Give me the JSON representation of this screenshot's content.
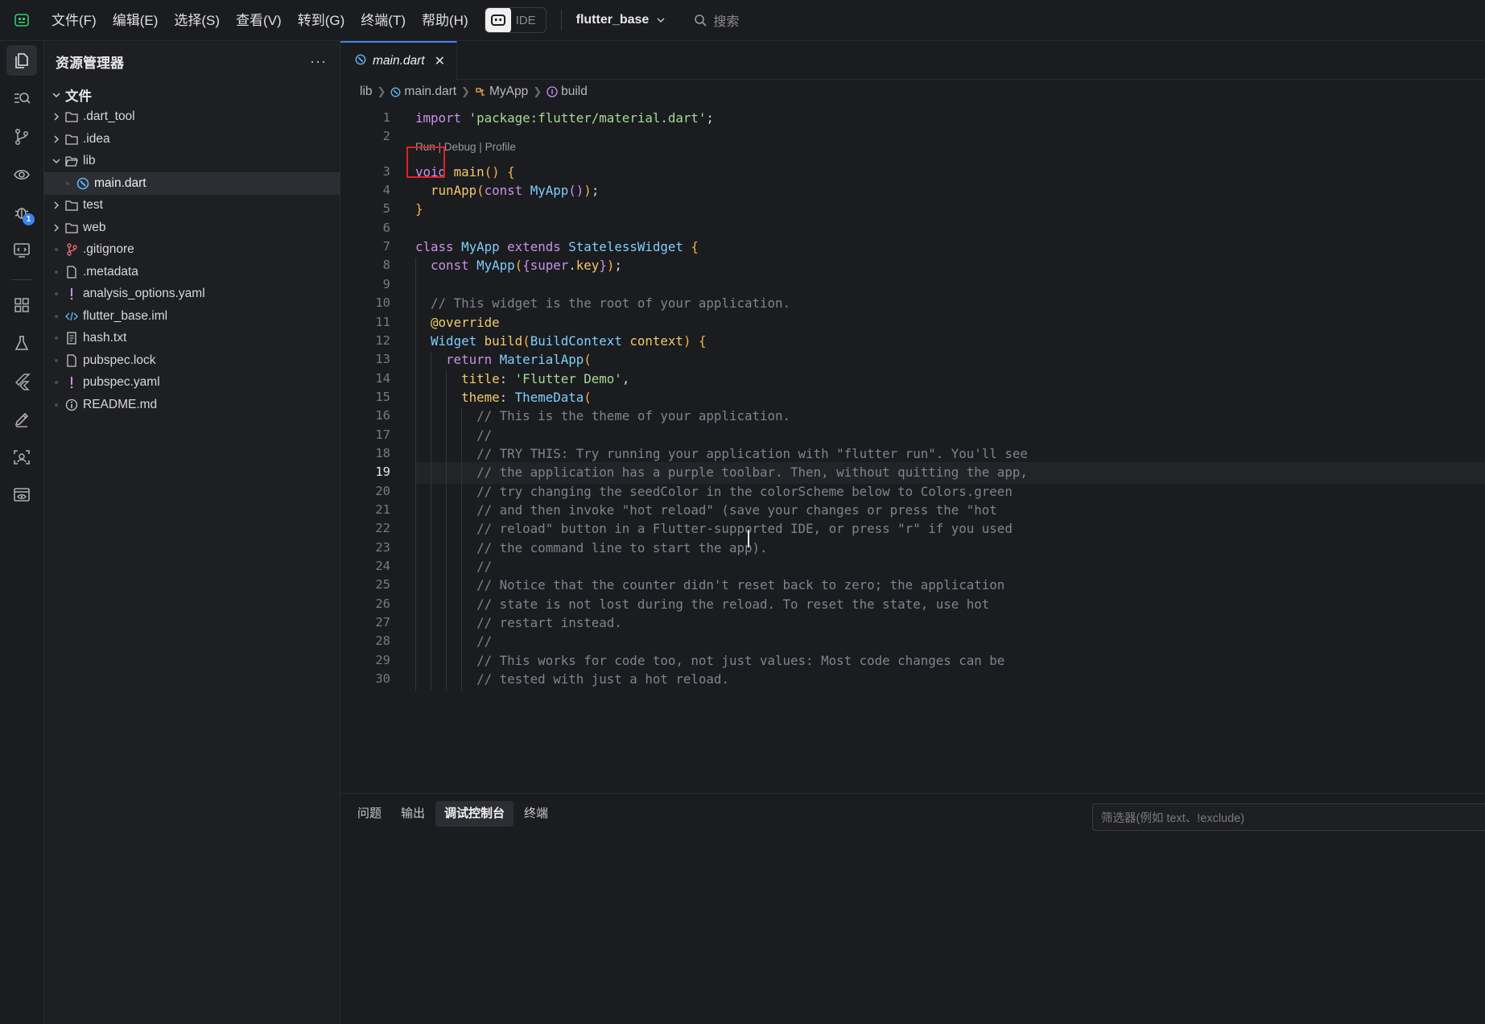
{
  "menu": [
    "文件(F)",
    "编辑(E)",
    "选择(S)",
    "查看(V)",
    "转到(G)",
    "终端(T)",
    "帮助(H)"
  ],
  "ide_badge": "IDE",
  "project": "flutter_base",
  "search_label": "搜索",
  "activity_badge": "1",
  "sidebar": {
    "title": "资源管理器",
    "more": "···",
    "root": "文件",
    "items": [
      {
        "label": ".dart_tool",
        "kind": "folder",
        "expanded": false
      },
      {
        "label": ".idea",
        "kind": "folder",
        "expanded": false
      },
      {
        "label": "lib",
        "kind": "folder",
        "expanded": true
      },
      {
        "label": "main.dart",
        "kind": "dart",
        "selected": true
      },
      {
        "label": "test",
        "kind": "folder",
        "expanded": false
      },
      {
        "label": "web",
        "kind": "folder",
        "expanded": false
      },
      {
        "label": ".gitignore",
        "kind": "git"
      },
      {
        "label": ".metadata",
        "kind": "file"
      },
      {
        "label": "analysis_options.yaml",
        "kind": "yaml"
      },
      {
        "label": "flutter_base.iml",
        "kind": "code"
      },
      {
        "label": "hash.txt",
        "kind": "text"
      },
      {
        "label": "pubspec.lock",
        "kind": "file"
      },
      {
        "label": "pubspec.yaml",
        "kind": "yaml"
      },
      {
        "label": "README.md",
        "kind": "info"
      }
    ]
  },
  "editor": {
    "tab": "main.dart",
    "tab_close": "✕",
    "breadcrumb": [
      "lib",
      "main.dart",
      "MyApp",
      "build"
    ],
    "codelens": "Run | Debug | Profile",
    "current_line": 19,
    "line_numbers": [
      "1",
      "2",
      "3",
      "4",
      "5",
      "6",
      "7",
      "8",
      "9",
      "10",
      "11",
      "12",
      "13",
      "14",
      "15",
      "16",
      "17",
      "18",
      "19",
      "20",
      "21",
      "22",
      "23",
      "24",
      "25",
      "26",
      "27",
      "28",
      "29",
      "30"
    ],
    "lines": [
      "import 'package:flutter/material.dart';",
      "",
      "void main() {",
      "  runApp(const MyApp());",
      "}",
      "",
      "class MyApp extends StatelessWidget {",
      "  const MyApp({super.key});",
      "",
      "  // This widget is the root of your application.",
      "  @override",
      "  Widget build(BuildContext context) {",
      "    return MaterialApp(",
      "      title: 'Flutter Demo',",
      "      theme: ThemeData(",
      "        // This is the theme of your application.",
      "        //",
      "        // TRY THIS: Try running your application with \"flutter run\". You'll see",
      "        // the application has a purple toolbar. Then, without quitting the app,",
      "        // try changing the seedColor in the colorScheme below to Colors.green",
      "        // and then invoke \"hot reload\" (save your changes or press the \"hot",
      "        // reload\" button in a Flutter-supported IDE, or press \"r\" if you used",
      "        // the command line to start the app).",
      "        //",
      "        // Notice that the counter didn't reset back to zero; the application",
      "        // state is not lost during the reload. To reset the state, use hot",
      "        // restart instead.",
      "        //",
      "        // This works for code too, not just values: Most code changes can be",
      "        // tested with just a hot reload."
    ]
  },
  "panel": {
    "tabs": [
      "问题",
      "输出",
      "调试控制台",
      "终端"
    ],
    "active_tab": "调试控制台",
    "filter_placeholder": "筛选器(例如 text、!exclude)"
  },
  "colors": {
    "accent": "#3b82f6",
    "highlight_box": "#e02020",
    "keyword": "#c792ea",
    "string": "#a6da95",
    "type": "#7dcfff",
    "function": "#f3c969",
    "comment": "#7f848e"
  }
}
